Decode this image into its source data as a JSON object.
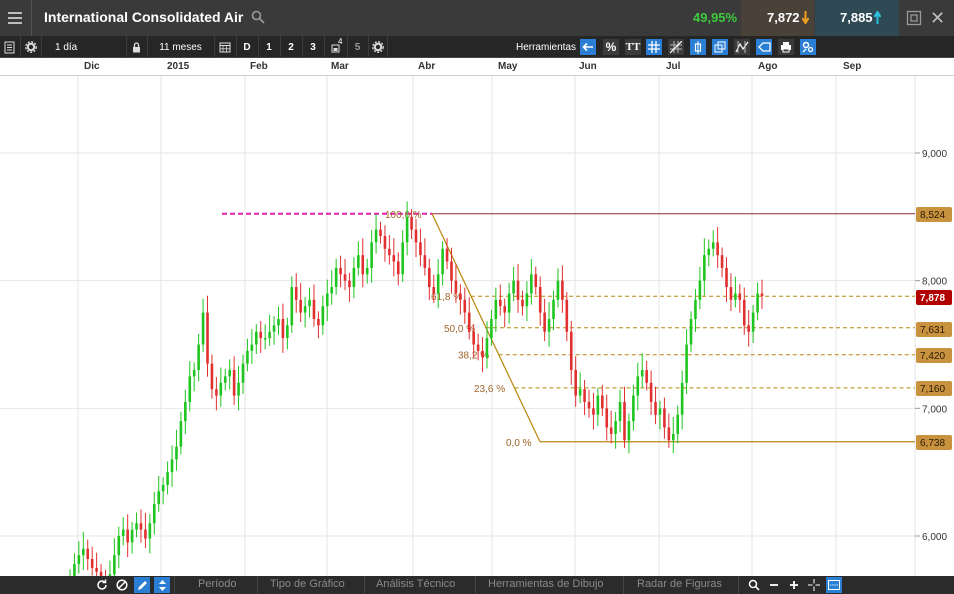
{
  "header": {
    "title": "International Consolidated Air",
    "change_pct": "49,95%",
    "sell_price": "7,872",
    "buy_price": "7,885"
  },
  "toolbar": {
    "interval": "1 día",
    "period": "11 meses",
    "timeframe_d": "D",
    "tf1": "1",
    "tf2": "2",
    "tf3": "3",
    "tf4_sup": "4",
    "tf5": "5",
    "tools_label": "Herramientas",
    "percent_label": "%",
    "text_tool_label": "TT"
  },
  "date_axis": [
    "Dic",
    "2015",
    "Feb",
    "Mar",
    "Abr",
    "May",
    "Jun",
    "Jul",
    "Ago",
    "Sep"
  ],
  "price_axis": [
    "9,000",
    "8,000",
    "7,000",
    "6,000"
  ],
  "price_tags": {
    "top_line": "8,524",
    "current": "7,878",
    "fib_61": "7,631",
    "fib_50": "7,420",
    "fib_38": "7,160",
    "low_line": "6,738"
  },
  "fib_labels": [
    "100,0 %",
    "61,8 %",
    "50,0 %",
    "38,2 %",
    "23,6 %",
    "0,0 %"
  ],
  "bottom": {
    "tabs": [
      "Período",
      "Tipo de Gráfico",
      "Análisis Técnico",
      "Herramientas de Dibujo",
      "Radar de Figuras"
    ]
  },
  "colors": {
    "up": "#1fc51f",
    "down": "#e03030",
    "fib_line": "#b8860b",
    "fib_tag": "#c8923f",
    "current_tag": "#b00000",
    "top_dashed": "#e020b0",
    "accent_blue": "#2a7fd4"
  },
  "chart_data": {
    "type": "candlestick",
    "y_range": [
      5.7,
      9.6
    ],
    "x_months": [
      "Dic",
      "2015",
      "Feb",
      "Mar",
      "Abr",
      "May",
      "Jun",
      "Jul",
      "Ago",
      "Sep"
    ],
    "fibonacci": {
      "high": 8.524,
      "low": 6.738,
      "levels": [
        {
          "pct": "100,0 %",
          "value": 8.524
        },
        {
          "pct": "61,8 %",
          "value": 7.878
        },
        {
          "pct": "50,0 %",
          "value": 7.631
        },
        {
          "pct": "38,2 %",
          "value": 7.42
        },
        {
          "pct": "23,6 %",
          "value": 7.16
        },
        {
          "pct": "0,0 %",
          "value": 6.738
        }
      ]
    },
    "closes": [
      5.68,
      5.78,
      5.85,
      5.9,
      5.82,
      5.75,
      5.72,
      5.65,
      5.6,
      5.7,
      5.85,
      6.0,
      6.05,
      5.95,
      6.05,
      6.1,
      6.05,
      5.98,
      6.1,
      6.25,
      6.35,
      6.4,
      6.5,
      6.6,
      6.7,
      6.9,
      7.05,
      7.25,
      7.3,
      7.5,
      7.75,
      7.35,
      7.15,
      7.1,
      7.2,
      7.25,
      7.3,
      7.1,
      7.2,
      7.35,
      7.45,
      7.5,
      7.6,
      7.55,
      7.55,
      7.6,
      7.65,
      7.7,
      7.55,
      7.65,
      7.95,
      7.85,
      7.75,
      7.8,
      7.85,
      7.7,
      7.65,
      7.8,
      7.9,
      7.95,
      8.1,
      8.05,
      8.0,
      7.95,
      8.1,
      8.2,
      8.05,
      8.1,
      8.3,
      8.4,
      8.35,
      8.25,
      8.2,
      8.15,
      8.05,
      8.3,
      8.5,
      8.4,
      8.3,
      8.2,
      8.1,
      7.95,
      7.9,
      8.05,
      8.25,
      8.15,
      8.0,
      7.9,
      7.85,
      7.75,
      7.6,
      7.5,
      7.45,
      7.4,
      7.55,
      7.7,
      7.85,
      7.8,
      7.75,
      7.9,
      8.0,
      7.85,
      7.8,
      7.9,
      8.05,
      7.95,
      7.75,
      7.6,
      7.7,
      7.85,
      8.0,
      7.85,
      7.6,
      7.3,
      7.1,
      7.15,
      7.05,
      7.0,
      6.95,
      7.1,
      7.0,
      6.85,
      6.8,
      6.9,
      7.05,
      6.75,
      6.9,
      7.1,
      7.25,
      7.3,
      7.2,
      7.05,
      6.95,
      7.0,
      6.85,
      6.75,
      6.8,
      6.95,
      7.2,
      7.5,
      7.7,
      7.85,
      8.0,
      8.2,
      8.25,
      8.3,
      8.2,
      8.1,
      7.95,
      7.85,
      7.9,
      7.85,
      7.65,
      7.6,
      7.75,
      7.9,
      7.88
    ]
  }
}
